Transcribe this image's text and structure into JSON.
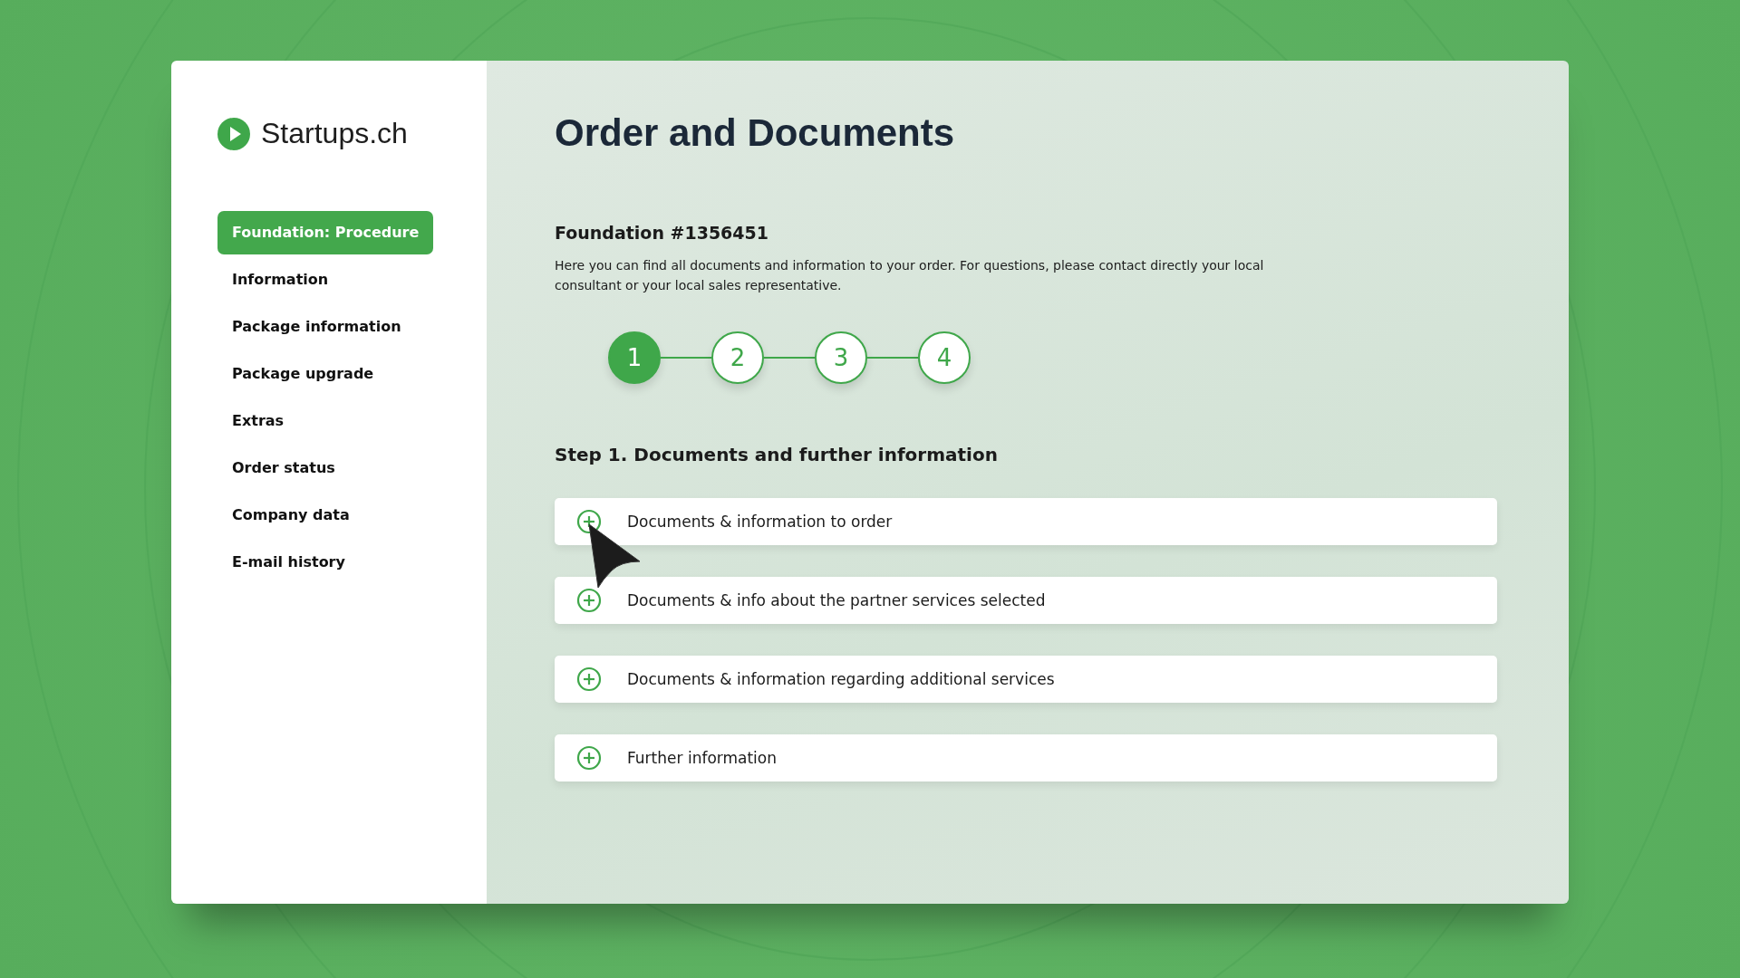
{
  "logo": {
    "text": "Startups.ch"
  },
  "sidebar": {
    "items": [
      {
        "label": "Foundation: Procedure",
        "selected": true
      },
      {
        "label": "Information",
        "selected": false
      },
      {
        "label": "Package information",
        "selected": false
      },
      {
        "label": "Package upgrade",
        "selected": false
      },
      {
        "label": "Extras",
        "selected": false
      },
      {
        "label": "Order status",
        "selected": false
      },
      {
        "label": "Company data",
        "selected": false
      },
      {
        "label": "E-mail history",
        "selected": false
      }
    ]
  },
  "page": {
    "title": "Order and Documents",
    "subtitle": "Foundation #1356451",
    "description": "Here you can find all documents and information to your order. For questions, please contact directly your local consultant or your local sales representative."
  },
  "steps": [
    {
      "label": "1",
      "selected": true
    },
    {
      "label": "2",
      "selected": false
    },
    {
      "label": "3",
      "selected": false
    },
    {
      "label": "4",
      "selected": false
    }
  ],
  "section": {
    "title": "Step 1. Documents and further information"
  },
  "accordion": [
    {
      "label": "Documents & information to order",
      "expanded": false
    },
    {
      "label": "Documents & info about the partner services selected",
      "expanded": false
    },
    {
      "label": "Documents & information regarding additional services",
      "expanded": false
    },
    {
      "label": "Further information",
      "expanded": false
    }
  ]
}
